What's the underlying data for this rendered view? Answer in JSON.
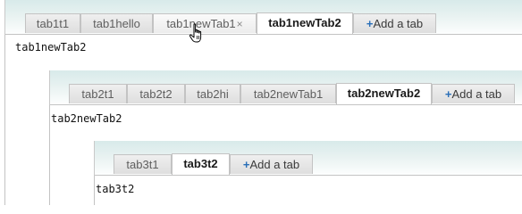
{
  "level1": {
    "tabs": [
      {
        "label": "tab1t1"
      },
      {
        "label": "tab1hello"
      },
      {
        "label": "tab1newTab1",
        "close": "×"
      },
      {
        "label": "tab1newTab2"
      }
    ],
    "add_tab": {
      "plus": "+",
      "label": "Add a tab"
    },
    "active_tab": "tab1newTab2",
    "content": "tab1newTab2"
  },
  "level2": {
    "tabs": [
      {
        "label": "tab2t1"
      },
      {
        "label": "tab2t2"
      },
      {
        "label": "tab2hi"
      },
      {
        "label": "tab2newTab1"
      },
      {
        "label": "tab2newTab2"
      }
    ],
    "add_tab": {
      "plus": "+",
      "label": "Add a tab"
    },
    "active_tab": "tab2newTab2",
    "content": "tab2newTab2"
  },
  "level3": {
    "tabs": [
      {
        "label": "tab3t1"
      },
      {
        "label": "tab3t2"
      }
    ],
    "add_tab": {
      "plus": "+",
      "label": "Add a tab"
    },
    "active_tab": "tab3t2",
    "content": "tab3t2"
  },
  "colors": {
    "tabbar_gradient_top": "#d8eaea",
    "border": "#c3c3c3",
    "plus_accent": "#2a6fb8"
  },
  "cursor": {
    "icon": "hand-pointer-icon"
  }
}
